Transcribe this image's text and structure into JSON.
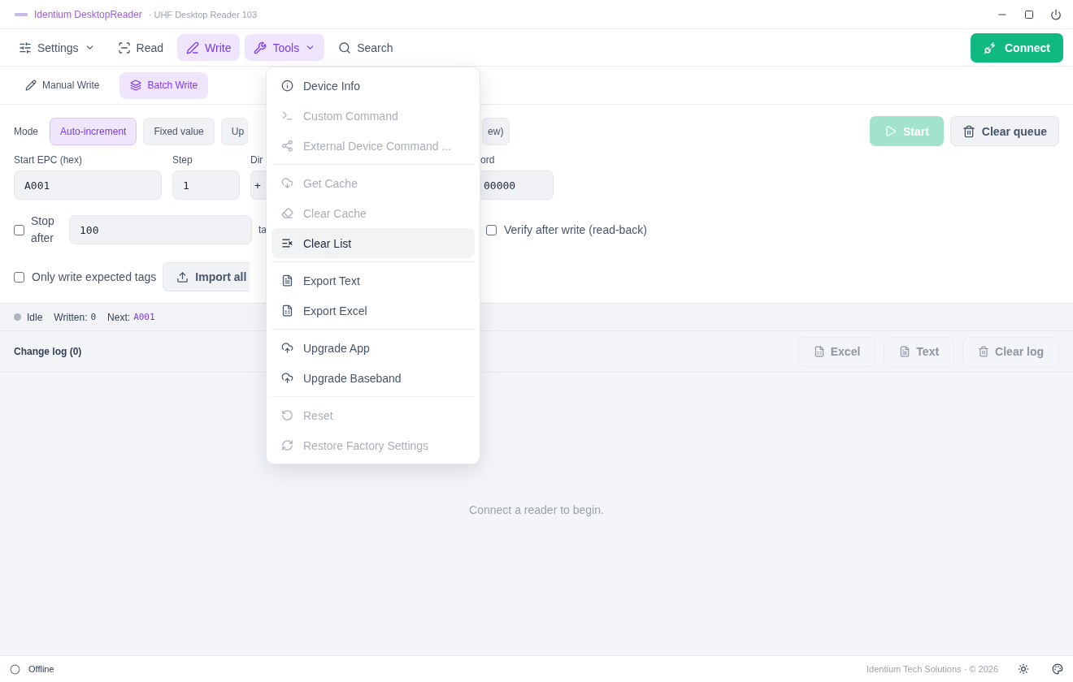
{
  "window": {
    "title": "Identium DesktopReader",
    "subtitle": "· UHF Desktop Reader 103"
  },
  "nav": {
    "items": [
      {
        "label": "Settings",
        "dropdown": true,
        "selected": false
      },
      {
        "label": "Read",
        "dropdown": false,
        "selected": false
      },
      {
        "label": "Write",
        "dropdown": false,
        "selected": true
      },
      {
        "label": "Tools",
        "dropdown": true,
        "selected": true
      },
      {
        "label": "Search",
        "dropdown": false,
        "selected": false
      }
    ],
    "connect": "Connect"
  },
  "subtabs": [
    {
      "label": "Manual Write",
      "selected": false
    },
    {
      "label": "Batch Write",
      "selected": true
    }
  ],
  "form": {
    "mode_label": "Mode",
    "modes": [
      {
        "label": "Auto-increment",
        "selected": true
      },
      {
        "label": "Fixed value",
        "selected": false
      },
      {
        "label": "Up",
        "selected": false
      },
      {
        "label": "ew)",
        "selected": false
      }
    ],
    "start": "Start",
    "clear_queue": "Clear queue",
    "fields": [
      {
        "label": "Start EPC (hex)",
        "value": "A001"
      },
      {
        "label": "Step",
        "value": "1"
      },
      {
        "label": "Dir",
        "value": "+"
      },
      {
        "label": "ord",
        "value": "00000"
      }
    ],
    "stop_after": {
      "label": "Stop after",
      "checked": false,
      "value": "100",
      "unit": "ta"
    },
    "verify": {
      "label": "Verify after write (read-back)",
      "checked": false
    },
    "only_expected": {
      "label": "Only write expected tags",
      "checked": false
    },
    "import": "Import all"
  },
  "status": {
    "state": "Idle",
    "written_label": "Written:",
    "written": "0",
    "next_label": "Next:",
    "next": "A001"
  },
  "log": {
    "title": "Change log (0)",
    "buttons": [
      {
        "label": "Excel",
        "disabled": true
      },
      {
        "label": "Text",
        "disabled": true
      },
      {
        "label": "Clear log",
        "disabled": true
      }
    ],
    "empty": "Connect a reader to begin."
  },
  "menu": {
    "groups": [
      [
        {
          "label": "Device Info",
          "disabled": false,
          "selected": false
        },
        {
          "label": "Custom Command",
          "disabled": true,
          "selected": false
        },
        {
          "label": "External Device Command ...",
          "disabled": true,
          "selected": false
        }
      ],
      [
        {
          "label": "Get Cache",
          "disabled": true,
          "selected": false
        },
        {
          "label": "Clear Cache",
          "disabled": true,
          "selected": false
        },
        {
          "label": "Clear List",
          "disabled": false,
          "selected": true
        }
      ],
      [
        {
          "label": "Export Text",
          "disabled": false,
          "selected": false
        },
        {
          "label": "Export Excel",
          "disabled": false,
          "selected": false
        }
      ],
      [
        {
          "label": "Upgrade App",
          "disabled": false,
          "selected": false
        },
        {
          "label": "Upgrade Baseband",
          "disabled": false,
          "selected": false
        }
      ],
      [
        {
          "label": "Reset",
          "disabled": true,
          "selected": false
        },
        {
          "label": "Restore Factory Settings",
          "disabled": true,
          "selected": false
        }
      ]
    ]
  },
  "footer": {
    "status": "Offline",
    "copyright": "Identium Tech Solutions · © 2026"
  }
}
